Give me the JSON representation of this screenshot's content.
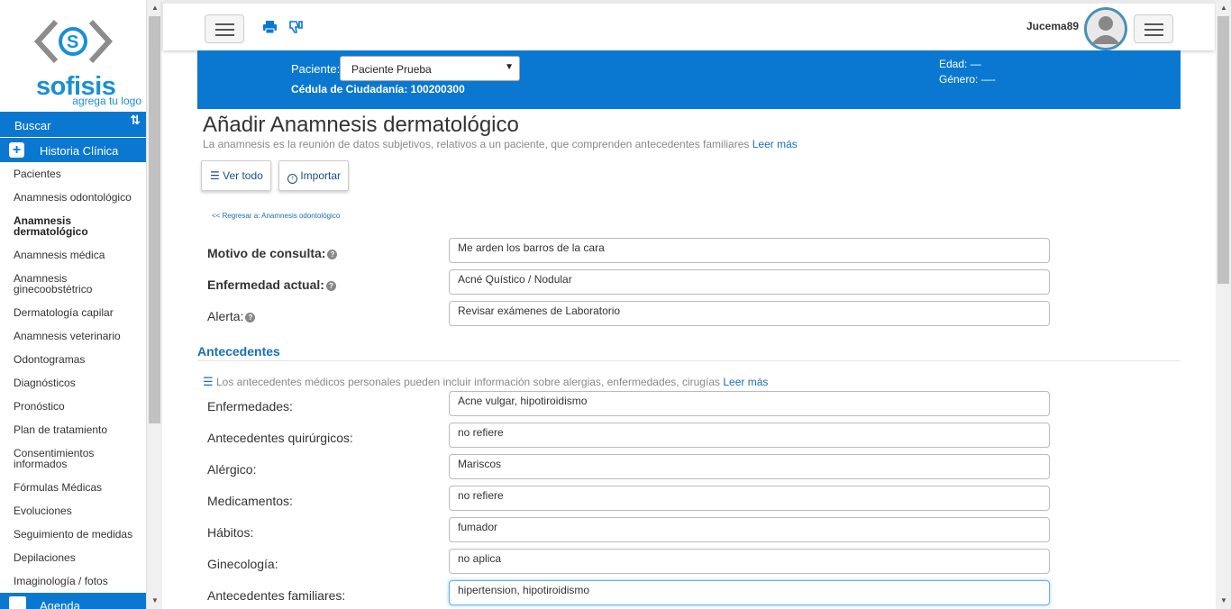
{
  "sidebar": {
    "logo_text": "sofisis",
    "logo_tagline": "agrega tu logo",
    "search_label": "Buscar",
    "sort_icon": "sort-arrows-icon",
    "section_label": "Historia Clínica",
    "items": [
      {
        "label": "Pacientes"
      },
      {
        "label": "Anamnesis odontológico"
      },
      {
        "label": "Anamnesis dermatológico",
        "active": true
      },
      {
        "label": "Anamnesis médica"
      },
      {
        "label": "Anamnesis ginecoobstétrico"
      },
      {
        "label": "Dermatología capilar"
      },
      {
        "label": "Anamnesis veterinario"
      },
      {
        "label": "Odontogramas"
      },
      {
        "label": "Diagnósticos"
      },
      {
        "label": "Pronóstico"
      },
      {
        "label": "Plan de tratamiento"
      },
      {
        "label": "Consentimientos informados"
      },
      {
        "label": "Fórmulas Médicas"
      },
      {
        "label": "Evoluciones"
      },
      {
        "label": "Seguimiento de medidas"
      },
      {
        "label": "Depilaciones"
      },
      {
        "label": "Imaginología / fotos"
      }
    ],
    "agenda_label": "Agenda"
  },
  "topbar": {
    "user_name": "Jucema89",
    "icons": [
      "menu-icon",
      "print-icon",
      "dislike-icon",
      "user-avatar-icon",
      "menu-icon"
    ]
  },
  "patient": {
    "label": "Paciente:",
    "selected": "Paciente Prueba",
    "id_line": "Cédula de Ciudadanía: 100200300",
    "age": "Edad: —",
    "gender": "Género: —-"
  },
  "main": {
    "title": "Añadir Anamnesis dermatológico",
    "description": "La anamnesis es la reunión de datos subjetivos, relativos a un paciente, que comprenden antecedentes familiares",
    "read_more": "Leer más",
    "btn_view_all": "Ver todo",
    "btn_import": "Importar",
    "back_link": "<< Regresar a: Anamnesis odontológico",
    "fields": {
      "motivo": {
        "label": "Motivo de consulta:",
        "value": "Me arden los barros de la cara"
      },
      "enfermedad": {
        "label": "Enfermedad actual:",
        "value": "Acné Quístico / Nodular"
      },
      "alerta": {
        "label": "Alerta:",
        "value": "Revisar exámenes de Laboratorio"
      }
    },
    "antecedentes": {
      "title": "Antecedentes",
      "description": "Los antecedentes médicos personales pueden incluir información sobre alergias, enfermedades, cirugías",
      "read_more": "Leer más",
      "rows": [
        {
          "label": "Enfermedades:",
          "value": "Acne vulgar, hipotiroidismo"
        },
        {
          "label": "Antecedentes quirúrgicos:",
          "value": "no refiere"
        },
        {
          "label": "Alérgico:",
          "value": "Mariscos"
        },
        {
          "label": "Medicamentos:",
          "value": "no refiere"
        },
        {
          "label": "Hábitos:",
          "value": "fumador"
        },
        {
          "label": "Ginecología:",
          "value": "no aplica"
        },
        {
          "label": "Antecedentes familiares:",
          "value": "hipertension, hipotiroidismo"
        }
      ]
    }
  }
}
